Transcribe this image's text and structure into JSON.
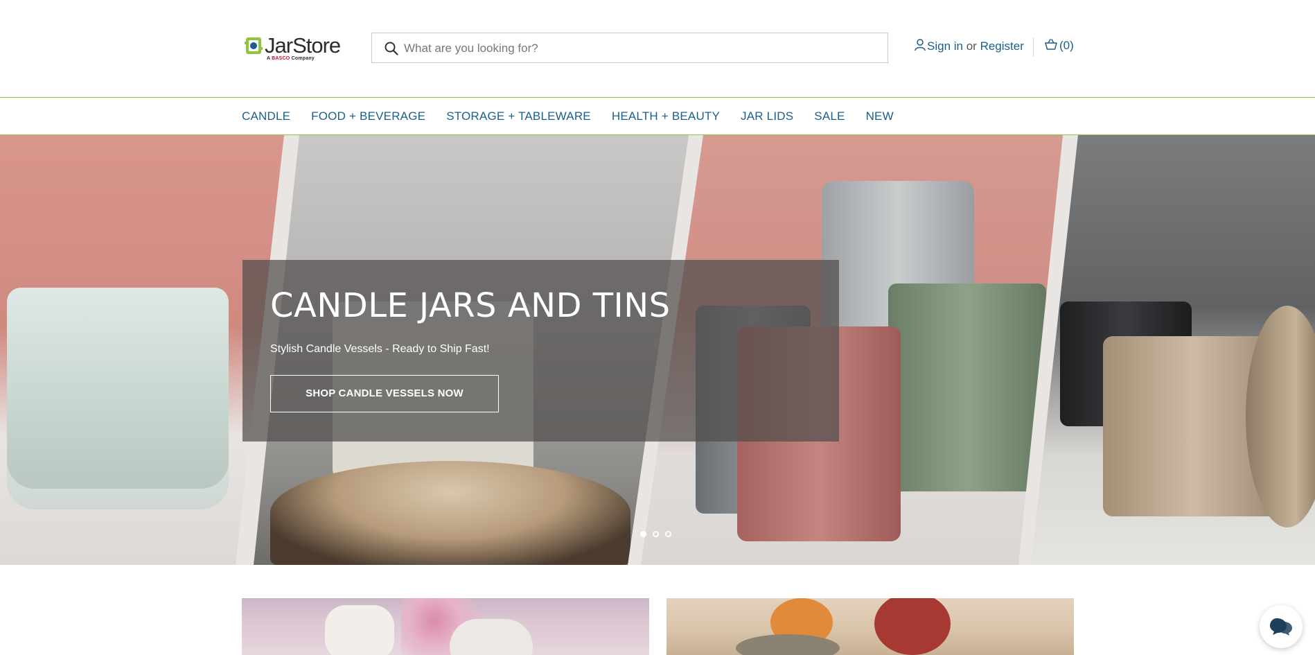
{
  "header": {
    "logo_text": "JarStore",
    "logo_tagline_prefix": "A",
    "logo_tagline_brand": "BASCO",
    "logo_tagline_suffix": "Company",
    "search_placeholder": "What are you looking for?",
    "sign_in": "Sign in",
    "or": "or",
    "register": "Register",
    "cart_count": "(0)"
  },
  "nav": {
    "items": [
      "CANDLE",
      "FOOD + BEVERAGE",
      "STORAGE + TABLEWARE",
      "HEALTH + BEAUTY",
      "JAR LIDS",
      "SALE",
      "NEW"
    ]
  },
  "hero": {
    "title": "CANDLE JARS AND TINS",
    "subtitle": "Stylish Candle Vessels - Ready to Ship Fast!",
    "button": "SHOP CANDLE VESSELS NOW",
    "slides_total": 3,
    "active_slide": 1
  },
  "colors": {
    "brand_blue": "#1a5f8c",
    "brand_green": "#8dc63f",
    "overlay": "#504e4c"
  }
}
